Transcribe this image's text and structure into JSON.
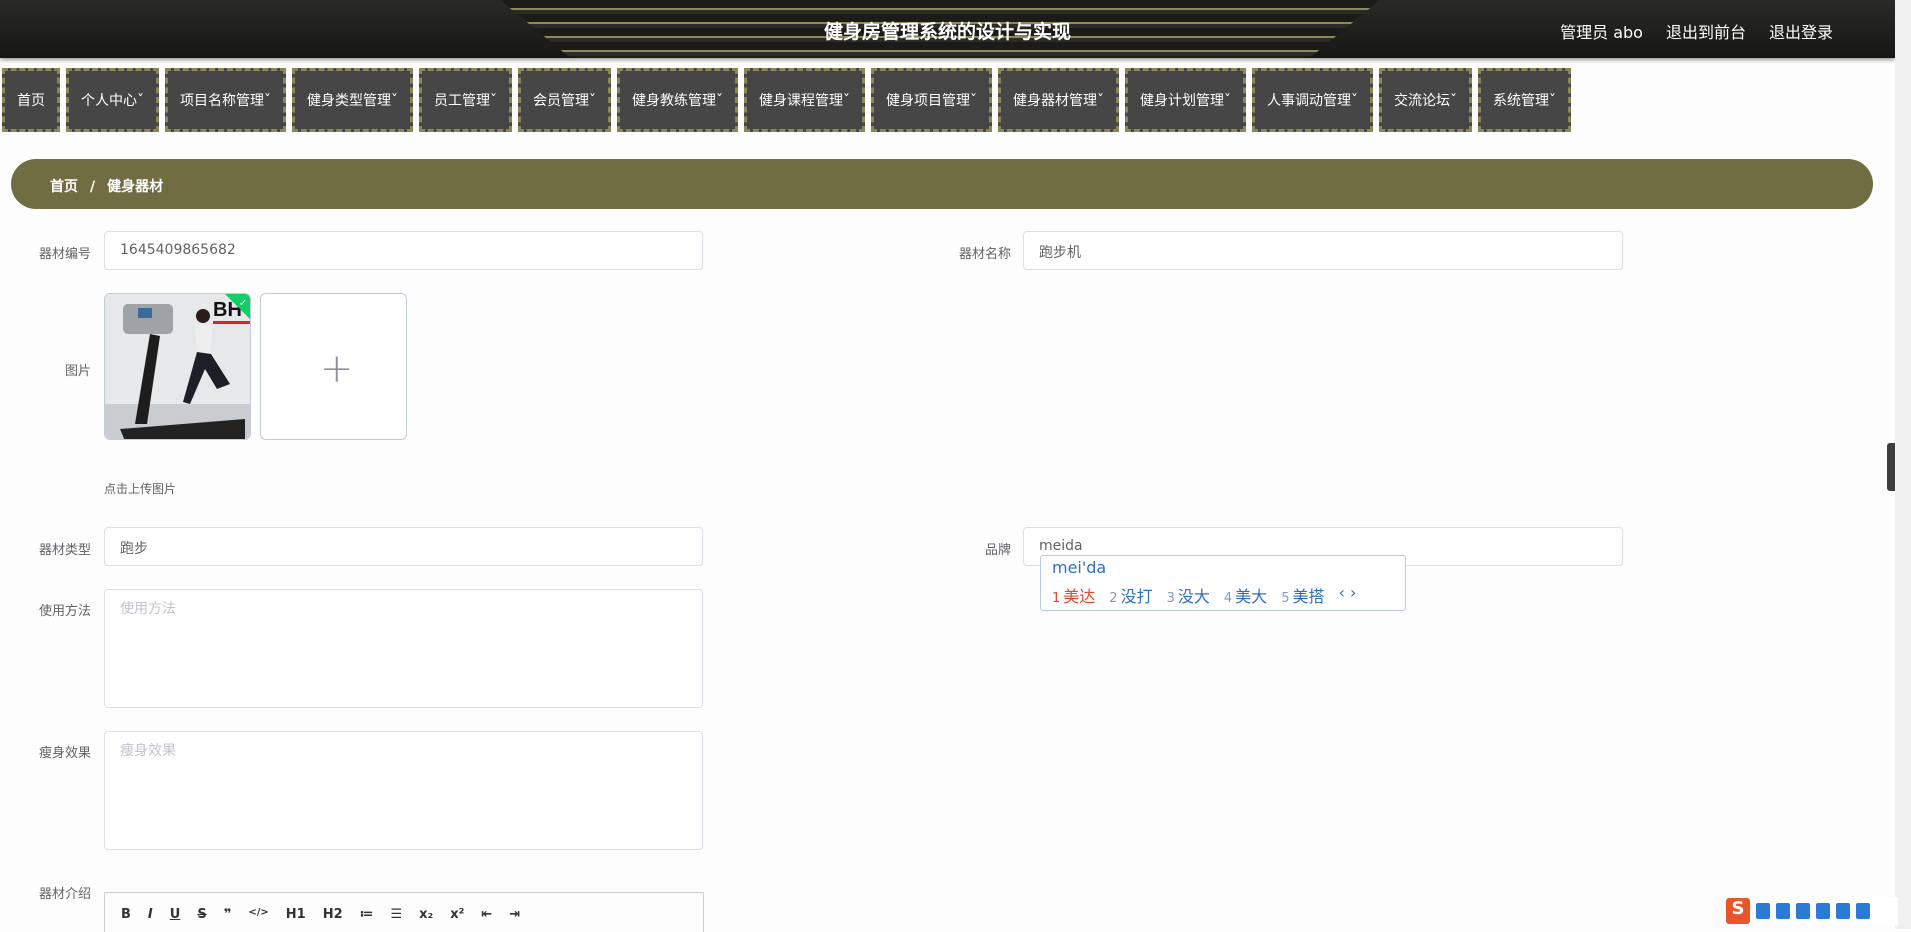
{
  "header": {
    "title": "健身房管理系统的设计与实现",
    "user": "管理员 abo",
    "links": [
      "退出到前台",
      "退出登录"
    ]
  },
  "nav": [
    "首页",
    "个人中心ˇ",
    "项目名称管理ˇ",
    "健身类型管理ˇ",
    "员工管理ˇ",
    "会员管理ˇ",
    "健身教练管理ˇ",
    "健身课程管理ˇ",
    "健身项目管理ˇ",
    "健身器材管理ˇ",
    "健身计划管理ˇ",
    "人事调动管理ˇ",
    "交流论坛ˇ",
    "系统管理ˇ"
  ],
  "breadcrumb": [
    "首页",
    "/",
    "健身器材"
  ],
  "form": {
    "code_label": "器材编号",
    "code_value": "1645409865682",
    "name_label": "器材名称",
    "name_value": "跑步机",
    "image_label": "图片",
    "upload_hint": "点击上传图片",
    "upload_plus": "+",
    "type_label": "器材类型",
    "type_value": "跑步",
    "brand_label": "品牌",
    "brand_value": "meida",
    "usage_label": "使用方法",
    "usage_placeholder": "使用方法",
    "effect_label": "瘦身效果",
    "effect_placeholder": "瘦身效果",
    "intro_label": "器材介绍"
  },
  "editor_toolbar": [
    "B",
    "I",
    "U",
    "S",
    "❞",
    "</>",
    "H1",
    "H2",
    "≔",
    "☰",
    "x₂",
    "x²",
    "⇤",
    "⇥"
  ],
  "ime": {
    "pinyin": "mei'da",
    "candidates": [
      {
        "n": "1",
        "t": "美达"
      },
      {
        "n": "2",
        "t": "没打"
      },
      {
        "n": "3",
        "t": "没大"
      },
      {
        "n": "4",
        "t": "美大"
      },
      {
        "n": "5",
        "t": "美搭"
      }
    ],
    "pager": "‹ ›"
  },
  "side_tab": "‹",
  "colors": {
    "accent": "#706d42",
    "nav_bg": "#464646"
  }
}
